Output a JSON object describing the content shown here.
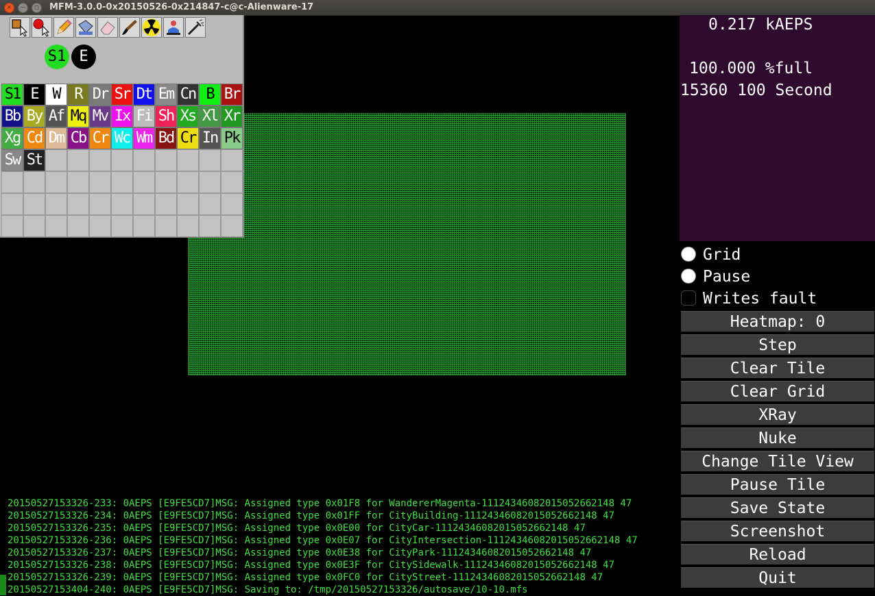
{
  "window": {
    "title": "MFM-3.0.0-0x20150526-0x214847-c@c-Alienware-17"
  },
  "tool_icons": [
    "selector-icon",
    "atom-selector-icon",
    "pencil-icon",
    "bucket-icon",
    "eraser-icon",
    "brush-icon",
    "nuke-icon",
    "xray-person-icon",
    "airbrush-icon"
  ],
  "selection": {
    "left_label": "S1",
    "right_label": "E",
    "left_color": "#22dd22",
    "right_color": "#000000"
  },
  "palette": [
    {
      "label": "S1",
      "bg": "#22dd22",
      "fg": "#000"
    },
    {
      "label": "E",
      "bg": "#000000",
      "fg": "#fff"
    },
    {
      "label": "W",
      "bg": "#ffffff",
      "fg": "#000"
    },
    {
      "label": "R",
      "bg": "#7a7a20",
      "fg": "#fff"
    },
    {
      "label": "Dr",
      "bg": "#7a7a7a",
      "fg": "#fff"
    },
    {
      "label": "Sr",
      "bg": "#ee1111",
      "fg": "#fff"
    },
    {
      "label": "Dt",
      "bg": "#1111ee",
      "fg": "#fff"
    },
    {
      "label": "Em",
      "bg": "#888888",
      "fg": "#fff"
    },
    {
      "label": "Cn",
      "bg": "#333333",
      "fg": "#fff"
    },
    {
      "label": "B",
      "bg": "#11ee11",
      "fg": "#000"
    },
    {
      "label": "Br",
      "bg": "#aa1111",
      "fg": "#fff"
    },
    {
      "label": "Bb",
      "bg": "#111188",
      "fg": "#fff"
    },
    {
      "label": "By",
      "bg": "#aaaa22",
      "fg": "#fff"
    },
    {
      "label": "Af",
      "bg": "#555555",
      "fg": "#fff"
    },
    {
      "label": "Mq",
      "bg": "#eeee11",
      "fg": "#000"
    },
    {
      "label": "Mv",
      "bg": "#6a3a88",
      "fg": "#fff"
    },
    {
      "label": "Ix",
      "bg": "#ee11ee",
      "fg": "#fff"
    },
    {
      "label": "Fi",
      "bg": "#bbbbbb",
      "fg": "#fff"
    },
    {
      "label": "Sh",
      "bg": "#ee2255",
      "fg": "#fff"
    },
    {
      "label": "Xs",
      "bg": "#22aa22",
      "fg": "#fff"
    },
    {
      "label": "Xl",
      "bg": "#449944",
      "fg": "#fff"
    },
    {
      "label": "Xr",
      "bg": "#229922",
      "fg": "#fff"
    },
    {
      "label": "Xg",
      "bg": "#44aa44",
      "fg": "#fff"
    },
    {
      "label": "Cd",
      "bg": "#ee8811",
      "fg": "#fff"
    },
    {
      "label": "Dm",
      "bg": "#ddbb99",
      "fg": "#fff"
    },
    {
      "label": "Cb",
      "bg": "#881188",
      "fg": "#fff"
    },
    {
      "label": "Cr",
      "bg": "#ee8811",
      "fg": "#fff"
    },
    {
      "label": "Wc",
      "bg": "#11eeee",
      "fg": "#fff"
    },
    {
      "label": "Wm",
      "bg": "#ee22ee",
      "fg": "#fff"
    },
    {
      "label": "Bd",
      "bg": "#881111",
      "fg": "#fff"
    },
    {
      "label": "Cr",
      "bg": "#eedd11",
      "fg": "#000"
    },
    {
      "label": "In",
      "bg": "#555555",
      "fg": "#fff"
    },
    {
      "label": "Pk",
      "bg": "#88cc88",
      "fg": "#000"
    },
    {
      "label": "Sw",
      "bg": "#888888",
      "fg": "#fff"
    },
    {
      "label": "St",
      "bg": "#222222",
      "fg": "#fff"
    }
  ],
  "stats": {
    "aeps": "0.217 kAEPS",
    "full": "100.000 %full",
    "second": "15360 100 Second"
  },
  "checkboxes": [
    {
      "label": "Grid",
      "checked": true
    },
    {
      "label": "Pause",
      "checked": true
    },
    {
      "label": "Writes fault",
      "checked": false
    }
  ],
  "buttons": [
    "Heatmap: 0",
    "Step",
    "Clear Tile",
    "Clear Grid",
    "XRay",
    "Nuke",
    "Change Tile View",
    "Pause Tile",
    "Save State",
    "Screenshot",
    "Reload",
    "Quit"
  ],
  "log": [
    "20150527153326-233: 0AEPS [E9FE5CD7]MSG: Assigned type 0x01F8 for WandererMagenta-11124346082015052662148 47",
    "20150527153326-234: 0AEPS [E9FE5CD7]MSG: Assigned type 0x01FF for CityBuilding-11124346082015052662148 47",
    "20150527153326-235: 0AEPS [E9FE5CD7]MSG: Assigned type 0x0E00 for CityCar-11124346082015052662148 47",
    "20150527153326-236: 0AEPS [E9FE5CD7]MSG: Assigned type 0x0E07 for CityIntersection-11124346082015052662148 47",
    "20150527153326-237: 0AEPS [E9FE5CD7]MSG: Assigned type 0x0E38 for CityPark-11124346082015052662148 47",
    "20150527153326-238: 0AEPS [E9FE5CD7]MSG: Assigned type 0x0E3F for CitySidewalk-11124346082015052662148 47",
    "20150527153326-239: 0AEPS [E9FE5CD7]MSG: Assigned type 0x0FC0 for CityStreet-11124346082015052662148 47",
    "20150527153404-240: 0AEPS [E9FE5CD7]MSG: Saving to: /tmp/20150527153326/autosave/10-10.mfs"
  ]
}
